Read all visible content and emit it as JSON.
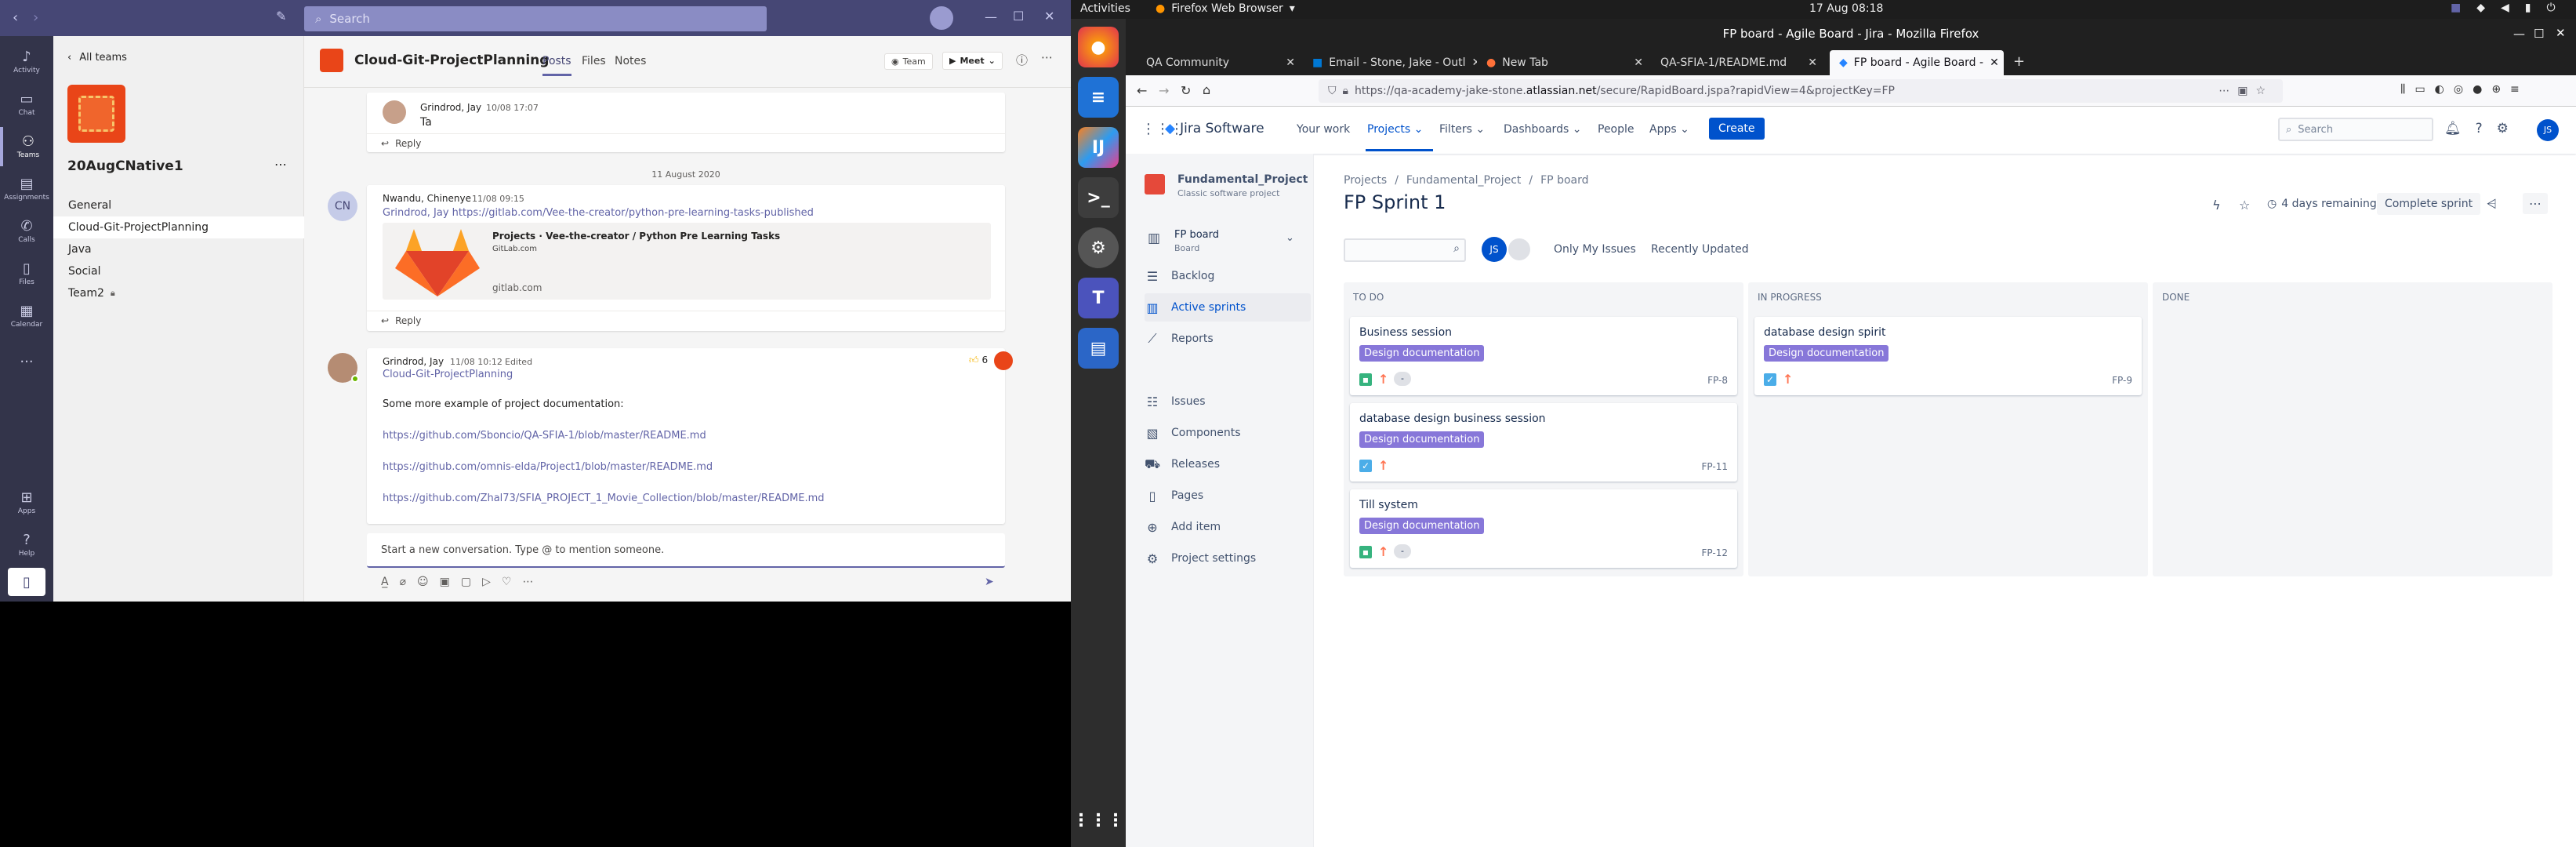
{
  "teams": {
    "search_placeholder": "Search",
    "rail": [
      {
        "label": "Activity",
        "icon": "bell-icon"
      },
      {
        "label": "Chat",
        "icon": "chat-icon"
      },
      {
        "label": "Teams",
        "icon": "teams-icon"
      },
      {
        "label": "Assignments",
        "icon": "assignments-icon"
      },
      {
        "label": "Calls",
        "icon": "phone-icon"
      },
      {
        "label": "Files",
        "icon": "file-icon"
      },
      {
        "label": "Calendar",
        "icon": "calendar-icon"
      },
      {
        "label": "...",
        "icon": "more-icon"
      },
      {
        "label": "Apps",
        "icon": "apps-icon"
      },
      {
        "label": "Help",
        "icon": "help-icon"
      }
    ],
    "all_teams": "All teams",
    "team_name": "20AugCNative1",
    "channels": [
      "General",
      "Cloud-Git-ProjectPlanning",
      "Java",
      "Social",
      "Team2"
    ],
    "channel_title": "Cloud-Git-ProjectPlanning",
    "tabs": [
      "Posts",
      "Files",
      "Notes"
    ],
    "team_btn": "Team",
    "meet_btn": "Meet",
    "msg1": {
      "author": "Grindrod, Jay",
      "time": "10/08 17:07",
      "text": "Ta"
    },
    "reply": "Reply",
    "date_divider": "11 August 2020",
    "msg2": {
      "initials": "CN",
      "author": "Nwandu, Chinenye",
      "time": "11/08 09:15",
      "text": "Grindrod, Jay https://gitlab.com/Vee-the-creator/python-pre-learning-tasks-published",
      "preview_title": "Projects · Vee-the-creator / Python Pre Learning Tasks",
      "preview_site": "GitLab.com",
      "preview_domain": "gitlab.com"
    },
    "msg3": {
      "author": "Grindrod, Jay",
      "time": "11/08 10:12",
      "edited": "Edited",
      "channel": "Cloud-Git-ProjectPlanning",
      "text": "Some more example of project documentation:",
      "links": [
        "https://github.com/Sboncio/QA-SFIA-1/blob/master/README.md",
        "https://github.com/omnis-elda/Project1/blob/master/README.md",
        "https://github.com/Zhal73/SFIA_PROJECT_1_Movie_Collection/blob/master/README.md"
      ],
      "likes": "6"
    },
    "compose_placeholder": "Start a new conversation. Type @ to mention someone."
  },
  "ubuntu": {
    "activities": "Activities",
    "app_menu": "Firefox Web Browser",
    "clock": "17 Aug  08:18"
  },
  "firefox": {
    "window_title": "FP board - Agile Board - Jira - Mozilla Firefox",
    "tabs": [
      "QA Community",
      "Email - Stone, Jake - Outl",
      "New Tab",
      "QA-SFIA-1/README.md",
      "FP board - Agile Board -"
    ],
    "url_prefix": "https://qa-academy-jake-stone.",
    "url_domain": "atlassian.net",
    "url_path": "/secure/RapidBoard.jspa?rapidView=4&projectKey=FP"
  },
  "jira": {
    "logo": "Jira Software",
    "nav": [
      "Your work",
      "Projects",
      "Filters",
      "Dashboards",
      "People",
      "Apps"
    ],
    "create": "Create",
    "search_placeholder": "Search",
    "avatar": "JS",
    "project_name": "Fundamental_Project",
    "project_type": "Classic software project",
    "board_name": "FP board",
    "board_sub": "Board",
    "sidebar": [
      {
        "label": "Backlog",
        "icon": "backlog-icon"
      },
      {
        "label": "Active sprints",
        "icon": "board-icon"
      },
      {
        "label": "Reports",
        "icon": "reports-icon"
      },
      {
        "label": "Issues",
        "icon": "issues-icon"
      },
      {
        "label": "Components",
        "icon": "components-icon"
      },
      {
        "label": "Releases",
        "icon": "releases-icon"
      },
      {
        "label": "Pages",
        "icon": "pages-icon"
      },
      {
        "label": "Add item",
        "icon": "add-icon"
      },
      {
        "label": "Project settings",
        "icon": "settings-icon"
      }
    ],
    "breadcrumb": [
      "Projects",
      "Fundamental_Project",
      "FP board"
    ],
    "sprint_title": "FP Sprint 1",
    "days_remaining": "4 days remaining",
    "complete_sprint": "Complete sprint",
    "filters": [
      "Only My Issues",
      "Recently Updated"
    ],
    "columns": [
      {
        "name": "TO DO",
        "issues": [
          {
            "title": "Business session",
            "epic": "Design documentation",
            "key": "FP-8",
            "type": "story",
            "est": "-"
          },
          {
            "title": "database design business session",
            "epic": "Design documentation",
            "key": "FP-11",
            "type": "task",
            "est": ""
          },
          {
            "title": "Till system",
            "epic": "Design documentation",
            "key": "FP-12",
            "type": "story",
            "est": "-"
          }
        ]
      },
      {
        "name": "IN PROGRESS",
        "issues": [
          {
            "title": "database design spirit",
            "epic": "Design documentation",
            "key": "FP-9",
            "type": "task",
            "est": ""
          }
        ]
      },
      {
        "name": "DONE",
        "issues": []
      }
    ],
    "colors": {
      "primary": "#0052cc",
      "epic": "#8777d9",
      "story": "#36b37e",
      "task": "#4bade8"
    }
  }
}
